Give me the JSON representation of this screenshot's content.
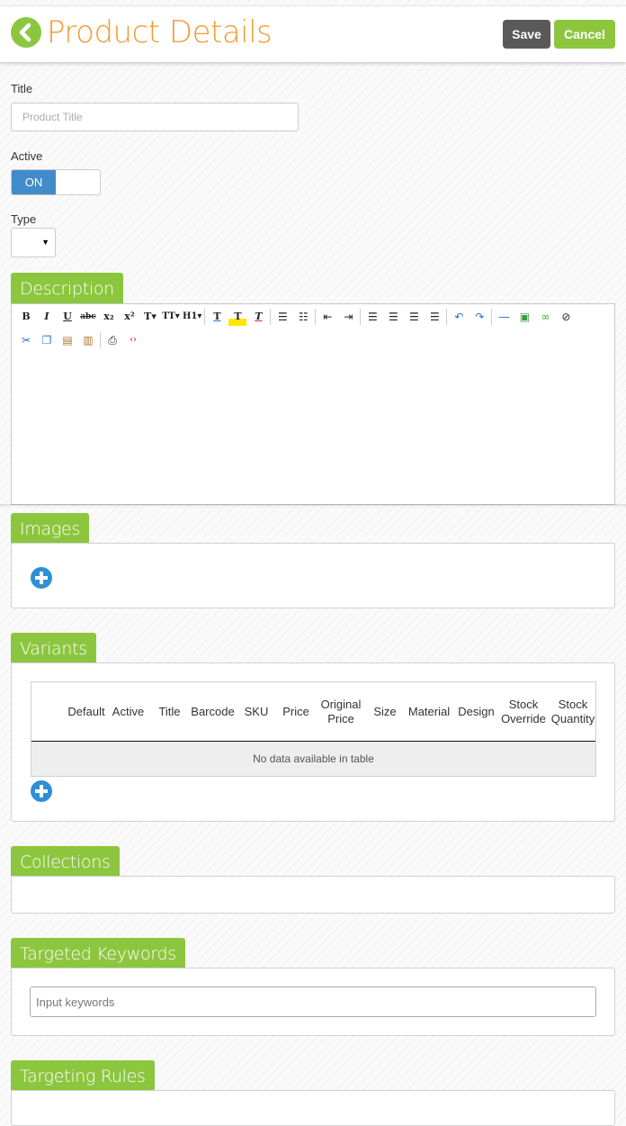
{
  "header": {
    "title": "Product Details",
    "save_label": "Save",
    "cancel_label": "Cancel",
    "accent_color": "#8cc63f",
    "title_color": "#f29b32"
  },
  "form": {
    "title_label": "Title",
    "title_placeholder": "Product Title",
    "active_label": "Active",
    "active_state": "ON",
    "type_label": "Type",
    "type_value": ""
  },
  "description": {
    "heading": "Description",
    "toolbar_row1": [
      {
        "name": "bold-icon",
        "glyph": "B"
      },
      {
        "name": "italic-icon",
        "glyph": "I"
      },
      {
        "name": "underline-icon",
        "glyph": "U"
      },
      {
        "name": "strikethrough-icon",
        "glyph": "abc"
      },
      {
        "name": "subscript-icon",
        "glyph": "x₂"
      },
      {
        "name": "superscript-icon",
        "glyph": "x²"
      },
      {
        "name": "font-family-icon",
        "glyph": "T▾"
      },
      {
        "name": "font-size-icon",
        "glyph": "TT▾"
      },
      {
        "name": "heading-icon",
        "glyph": "H1▾"
      },
      {
        "name": "text-color-icon",
        "glyph": "T"
      },
      {
        "name": "highlight-icon",
        "glyph": "T"
      },
      {
        "name": "clear-format-icon",
        "glyph": "T"
      },
      {
        "name": "bullet-list-icon",
        "glyph": "☰"
      },
      {
        "name": "numbered-list-icon",
        "glyph": "☷"
      },
      {
        "name": "outdent-icon",
        "glyph": "⇤"
      },
      {
        "name": "indent-icon",
        "glyph": "⇥"
      },
      {
        "name": "align-left-icon",
        "glyph": "☰"
      },
      {
        "name": "align-center-icon",
        "glyph": "☰"
      },
      {
        "name": "align-right-icon",
        "glyph": "☰"
      },
      {
        "name": "justify-icon",
        "glyph": "☰"
      },
      {
        "name": "undo-icon",
        "glyph": "↶"
      },
      {
        "name": "redo-icon",
        "glyph": "↷"
      },
      {
        "name": "horizontal-rule-icon",
        "glyph": "―"
      },
      {
        "name": "image-icon",
        "glyph": "▣"
      },
      {
        "name": "link-icon",
        "glyph": "∞"
      },
      {
        "name": "unlink-icon",
        "glyph": "⊘"
      }
    ],
    "toolbar_row2": [
      {
        "name": "cut-icon",
        "glyph": "✂"
      },
      {
        "name": "copy-icon",
        "glyph": "❐"
      },
      {
        "name": "paste-icon",
        "glyph": "📋"
      },
      {
        "name": "paste-text-icon",
        "glyph": "📋"
      },
      {
        "name": "print-icon",
        "glyph": "⎙"
      },
      {
        "name": "source-code-icon",
        "glyph": "‹›"
      }
    ]
  },
  "images": {
    "heading": "Images"
  },
  "variants": {
    "heading": "Variants",
    "columns": [
      "Default",
      "Active",
      "Title",
      "Barcode",
      "SKU",
      "Price",
      "Original Price",
      "Size",
      "Material",
      "Design",
      "Stock Override",
      "Stock Quantity"
    ],
    "empty_message": "No data available in table"
  },
  "collections": {
    "heading": "Collections"
  },
  "keywords": {
    "heading": "Targeted Keywords",
    "placeholder": "Input keywords"
  },
  "rules": {
    "heading": "Targeting Rules"
  }
}
